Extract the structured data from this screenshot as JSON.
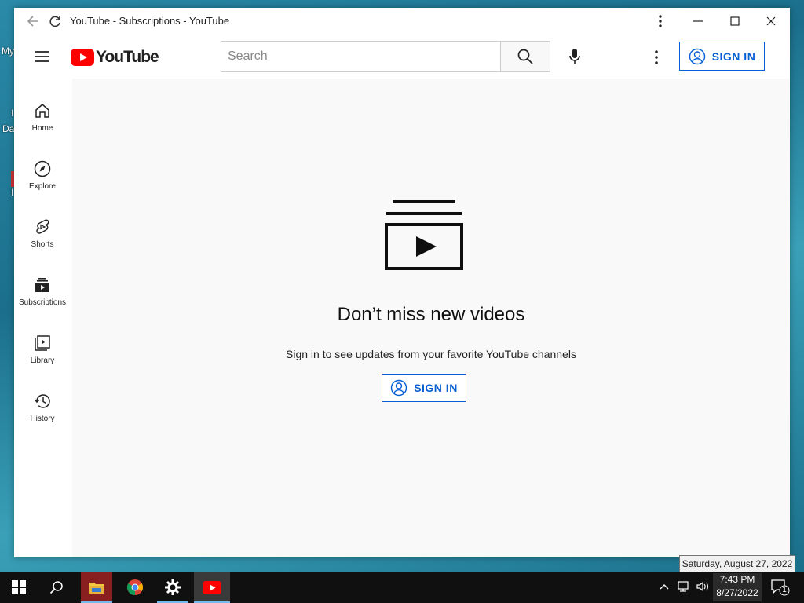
{
  "desktop": {
    "frag1": "My",
    "frag2": "I",
    "frag3": "Da",
    "frag4": "I"
  },
  "window": {
    "title": "YouTube - Subscriptions - YouTube"
  },
  "masthead": {
    "logo_text": "YouTube",
    "search_placeholder": "Search",
    "signin_label": "SIGN IN",
    "brand_color": "#ff0000",
    "accent_color": "#065fd4"
  },
  "sidebar": {
    "items": [
      {
        "label": "Home",
        "icon": "home-icon"
      },
      {
        "label": "Explore",
        "icon": "compass-icon"
      },
      {
        "label": "Shorts",
        "icon": "shorts-icon"
      },
      {
        "label": "Subscriptions",
        "icon": "subscriptions-icon"
      },
      {
        "label": "Library",
        "icon": "library-icon"
      },
      {
        "label": "History",
        "icon": "history-icon"
      }
    ]
  },
  "main": {
    "title": "Don’t miss new videos",
    "subtitle": "Sign in to see updates from your favorite YouTube channels",
    "signin_label": "SIGN IN"
  },
  "tooltip": {
    "text": "Saturday, August 27, 2022"
  },
  "taskbar": {
    "time": "7:43 PM",
    "date": "8/27/2022",
    "notification_count": "1"
  }
}
